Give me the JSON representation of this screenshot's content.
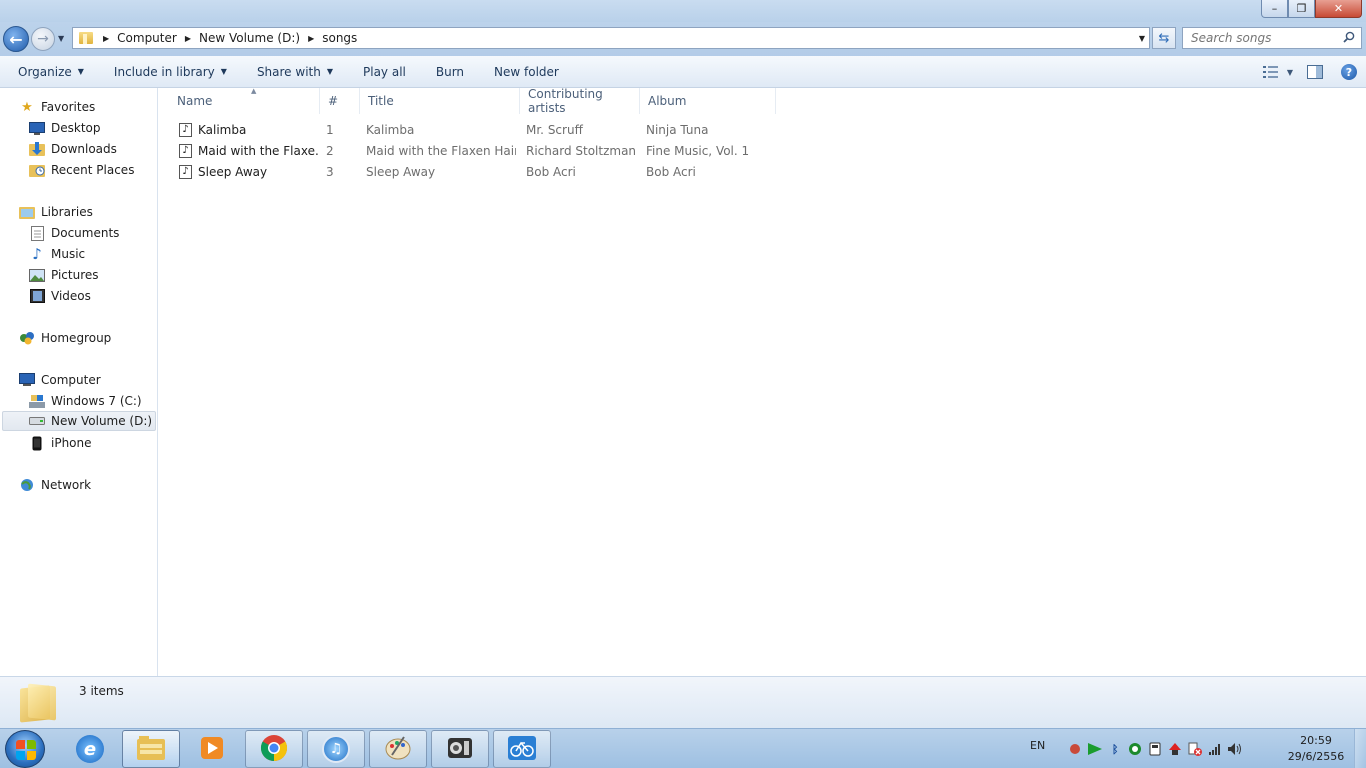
{
  "window": {
    "controls": [
      "–",
      "❐",
      "✕"
    ]
  },
  "address": {
    "crumbs": [
      "Computer",
      "New Volume (D:)",
      "songs"
    ],
    "search_placeholder": "Search songs"
  },
  "toolbar": {
    "organize": "Organize",
    "include_in_library": "Include in library",
    "share_with": "Share with",
    "play_all": "Play all",
    "burn": "Burn",
    "new_folder": "New folder"
  },
  "nav": {
    "favorites": "Favorites",
    "desktop": "Desktop",
    "downloads": "Downloads",
    "recent_places": "Recent Places",
    "libraries": "Libraries",
    "documents": "Documents",
    "music": "Music",
    "pictures": "Pictures",
    "videos": "Videos",
    "homegroup": "Homegroup",
    "computer": "Computer",
    "drive_c": "Windows 7 (C:)",
    "drive_d": "New Volume (D:)",
    "iphone": "iPhone",
    "network": "Network"
  },
  "columns": {
    "name": "Name",
    "number": "#",
    "title": "Title",
    "artists": "Contributing artists",
    "album": "Album"
  },
  "files": [
    {
      "name": "Kalimba",
      "number": "1",
      "title": "Kalimba",
      "artists": "Mr. Scruff",
      "album": "Ninja Tuna"
    },
    {
      "name": "Maid with the Flaxe...",
      "number": "2",
      "title": "Maid with the Flaxen Hair",
      "artists": "Richard Stoltzman...",
      "album": "Fine Music, Vol. 1"
    },
    {
      "name": "Sleep Away",
      "number": "3",
      "title": "Sleep Away",
      "artists": "Bob Acri",
      "album": "Bob Acri"
    }
  ],
  "status": {
    "item_count": "3 items"
  },
  "taskbar": {
    "language": "EN",
    "time": "20:59",
    "date": "29/6/2556"
  },
  "colors": {
    "chrome_blue": "#b9d1ea",
    "link_text": "#1e395b",
    "muted_text": "#6d6d6d"
  }
}
